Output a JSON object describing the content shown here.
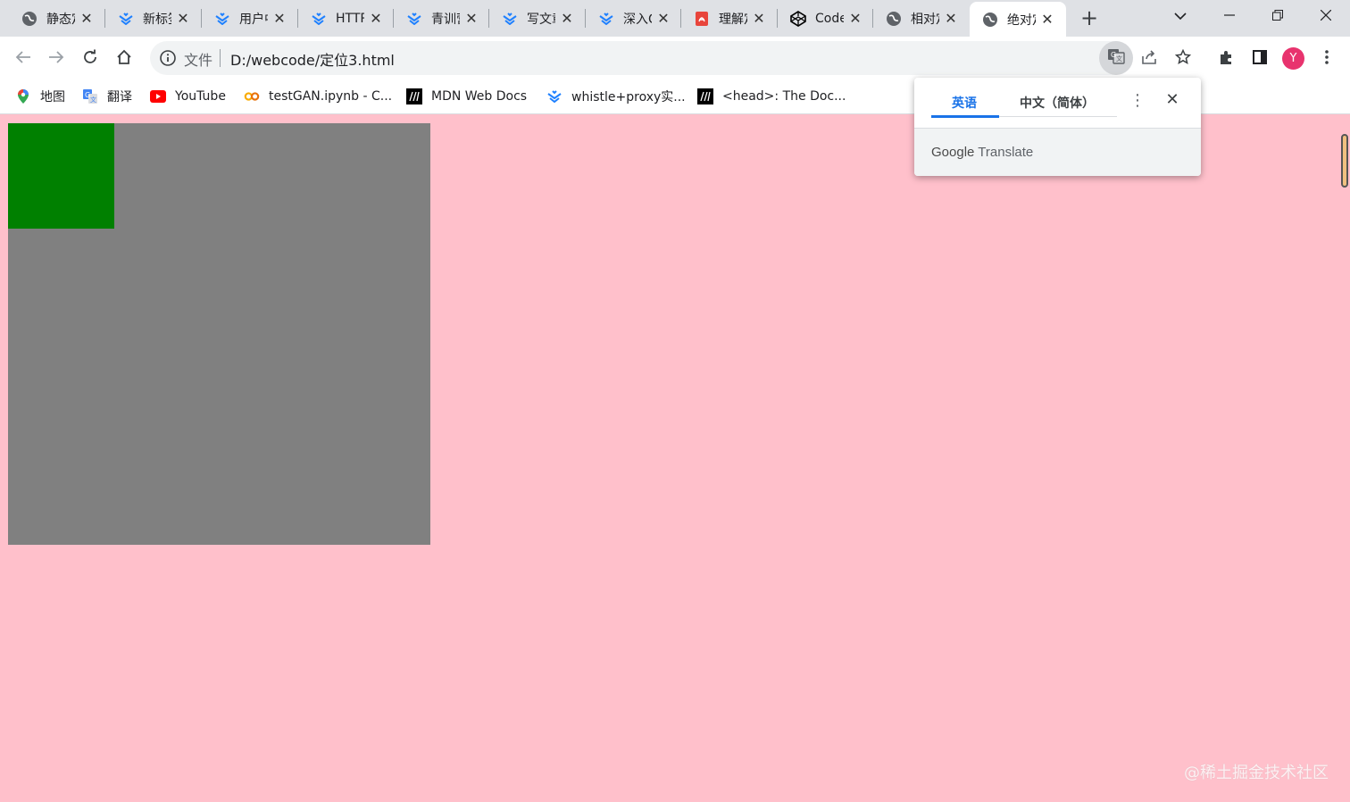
{
  "tabs": [
    {
      "title": "静态定位",
      "icon": "globe-icon"
    },
    {
      "title": "新标签页",
      "icon": "juejin-icon"
    },
    {
      "title": "用户中心",
      "icon": "juejin-icon"
    },
    {
      "title": "HTTP",
      "icon": "juejin-icon"
    },
    {
      "title": "青训营",
      "icon": "juejin-icon"
    },
    {
      "title": "写文章",
      "icon": "juejin-icon"
    },
    {
      "title": "深入CSS",
      "icon": "juejin-icon"
    },
    {
      "title": "理解定位",
      "icon": "pdf-icon"
    },
    {
      "title": "CodePen",
      "icon": "codepen-icon"
    },
    {
      "title": "相对定位",
      "icon": "globe-icon"
    },
    {
      "title": "绝对定位",
      "icon": "globe-icon",
      "active": true
    }
  ],
  "toolbar": {
    "scheme_label": "文件",
    "url": "D:/webcode/定位3.html",
    "avatar_letter": "Y"
  },
  "bookmarks": [
    {
      "label": "地图",
      "icon": "maps-pin-icon"
    },
    {
      "label": "翻译",
      "icon": "translate-icon"
    },
    {
      "label": "YouTube",
      "icon": "youtube-icon"
    },
    {
      "label": "testGAN.ipynb - C...",
      "icon": "colab-icon"
    },
    {
      "label": "MDN Web Docs",
      "icon": "mdn-icon"
    },
    {
      "label": "whistle+proxy实...",
      "icon": "juejin-icon"
    },
    {
      "label": "<head>: The Doc...",
      "icon": "mdn-icon"
    }
  ],
  "translate_popup": {
    "source_lang": "英语",
    "target_lang": "中文（简体）",
    "brand_google": "Google",
    "brand_translate": "Translate"
  },
  "page": {
    "background": "#ffc0cb",
    "outer_box_color": "#808080",
    "inner_box_color": "#008000"
  },
  "watermark": "@稀土掘金技术社区"
}
